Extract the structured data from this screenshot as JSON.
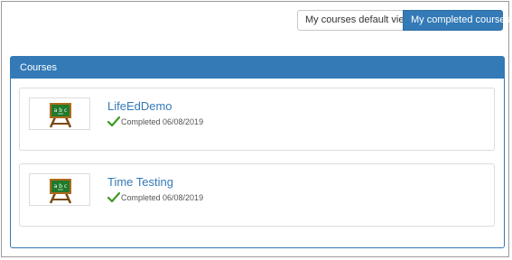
{
  "view_toggle": {
    "default_view_label": "My courses default view",
    "completed_label": "My completed courses"
  },
  "panel": {
    "title": "Courses"
  },
  "courses": [
    {
      "title": "LifeEdDemo",
      "status": "Completed 06/08/2019",
      "icon": "chalkboard-easel-icon"
    },
    {
      "title": "Time Testing",
      "status": "Completed 06/08/2019",
      "icon": "chalkboard-easel-icon"
    }
  ],
  "colors": {
    "primary": "#337ab7",
    "check": "#3a9a1f"
  },
  "icons": {
    "status": "checkmark-icon"
  }
}
